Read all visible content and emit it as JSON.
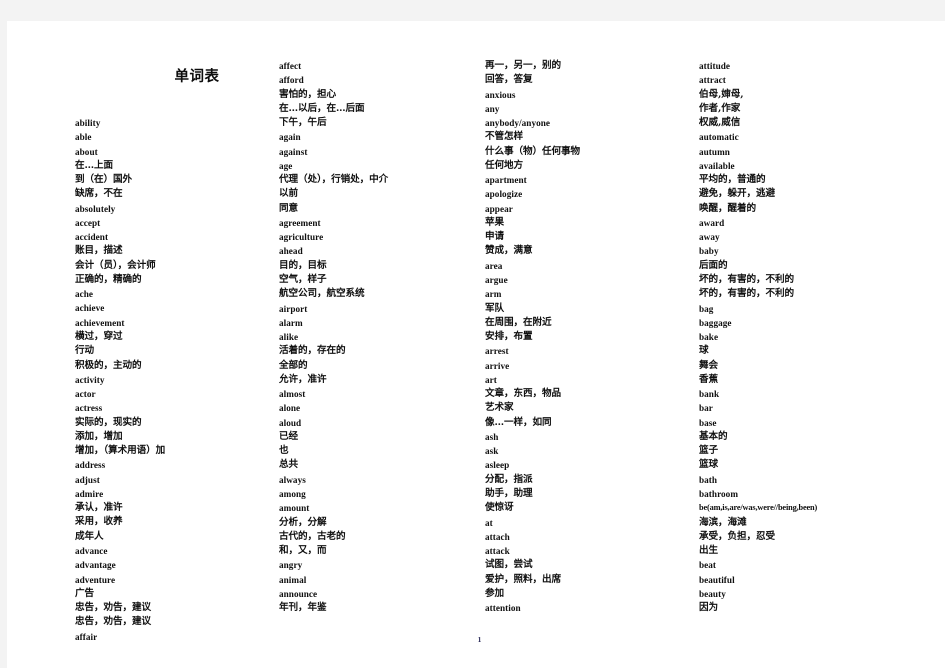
{
  "document": {
    "title": "单词表",
    "page_number": "1"
  },
  "columns": [
    {
      "id": "col-1",
      "entries": [
        {
          "text": "ability",
          "lang": "en"
        },
        {
          "text": "able",
          "lang": "en"
        },
        {
          "text": "about",
          "lang": "en"
        },
        {
          "text": "在…上面",
          "lang": "cn"
        },
        {
          "text": "到（在）国外",
          "lang": "cn"
        },
        {
          "text": "缺席，不在",
          "lang": "cn"
        },
        {
          "text": "absolutely",
          "lang": "en"
        },
        {
          "text": "accept",
          "lang": "en"
        },
        {
          "text": "accident",
          "lang": "en"
        },
        {
          "text": "账目，描述",
          "lang": "cn"
        },
        {
          "text": "会计（员），会计师",
          "lang": "cn"
        },
        {
          "text": "正确的，精确的",
          "lang": "cn"
        },
        {
          "text": "ache",
          "lang": "en"
        },
        {
          "text": "achieve",
          "lang": "en"
        },
        {
          "text": "achievement",
          "lang": "en"
        },
        {
          "text": "横过，穿过",
          "lang": "cn"
        },
        {
          "text": "行动",
          "lang": "cn"
        },
        {
          "text": "积极的，主动的",
          "lang": "cn"
        },
        {
          "text": "activity",
          "lang": "en"
        },
        {
          "text": "actor",
          "lang": "en"
        },
        {
          "text": "actress",
          "lang": "en"
        },
        {
          "text": "实际的，现实的",
          "lang": "cn"
        },
        {
          "text": "添加，增加",
          "lang": "cn"
        },
        {
          "text": "增加，（算术用语）加",
          "lang": "cn"
        },
        {
          "text": "address",
          "lang": "en"
        },
        {
          "text": "adjust",
          "lang": "en"
        },
        {
          "text": "admire",
          "lang": "en"
        },
        {
          "text": "承认，准许",
          "lang": "cn"
        },
        {
          "text": "采用，收养",
          "lang": "cn"
        },
        {
          "text": "成年人",
          "lang": "cn"
        },
        {
          "text": "advance",
          "lang": "en"
        },
        {
          "text": "advantage",
          "lang": "en"
        },
        {
          "text": "adventure",
          "lang": "en"
        },
        {
          "text": "广告",
          "lang": "cn"
        },
        {
          "text": "忠告，劝告，建议",
          "lang": "cn"
        },
        {
          "text": "忠告，劝告，建议",
          "lang": "cn"
        },
        {
          "text": "affair",
          "lang": "en"
        }
      ]
    },
    {
      "id": "col-2",
      "entries": [
        {
          "text": "affect",
          "lang": "en"
        },
        {
          "text": "afford",
          "lang": "en"
        },
        {
          "text": "害怕的，担心",
          "lang": "cn"
        },
        {
          "text": "在…以后，在…后面",
          "lang": "cn"
        },
        {
          "text": "下午，午后",
          "lang": "cn"
        },
        {
          "text": "again",
          "lang": "en"
        },
        {
          "text": "against",
          "lang": "en"
        },
        {
          "text": "age",
          "lang": "en"
        },
        {
          "text": "代理（处），行销处，中介",
          "lang": "cn"
        },
        {
          "text": "以前",
          "lang": "cn"
        },
        {
          "text": "同意",
          "lang": "cn"
        },
        {
          "text": "agreement",
          "lang": "en"
        },
        {
          "text": "agriculture",
          "lang": "en"
        },
        {
          "text": "ahead",
          "lang": "en"
        },
        {
          "text": "目的，目标",
          "lang": "cn"
        },
        {
          "text": "空气，样子",
          "lang": "cn"
        },
        {
          "text": "航空公司，航空系统",
          "lang": "cn"
        },
        {
          "text": "airport",
          "lang": "en"
        },
        {
          "text": "alarm",
          "lang": "en"
        },
        {
          "text": "alike",
          "lang": "en"
        },
        {
          "text": "活着的，存在的",
          "lang": "cn"
        },
        {
          "text": "全部的",
          "lang": "cn"
        },
        {
          "text": "允许，准许",
          "lang": "cn"
        },
        {
          "text": "almost",
          "lang": "en"
        },
        {
          "text": "alone",
          "lang": "en"
        },
        {
          "text": "aloud",
          "lang": "en"
        },
        {
          "text": "已经",
          "lang": "cn"
        },
        {
          "text": "也",
          "lang": "cn"
        },
        {
          "text": "总共",
          "lang": "cn"
        },
        {
          "text": "always",
          "lang": "en"
        },
        {
          "text": "among",
          "lang": "en"
        },
        {
          "text": "amount",
          "lang": "en"
        },
        {
          "text": "分析，分解",
          "lang": "cn"
        },
        {
          "text": "古代的，古老的",
          "lang": "cn"
        },
        {
          "text": "和，又，而",
          "lang": "cn"
        },
        {
          "text": "angry",
          "lang": "en"
        },
        {
          "text": "animal",
          "lang": "en"
        },
        {
          "text": "announce",
          "lang": "en"
        },
        {
          "text": "年刊，年鉴",
          "lang": "cn"
        }
      ]
    },
    {
      "id": "col-3",
      "entries": [
        {
          "text": "再一，另一，别的",
          "lang": "cn"
        },
        {
          "text": "回答，答复",
          "lang": "cn"
        },
        {
          "text": "anxious",
          "lang": "en"
        },
        {
          "text": "any",
          "lang": "en"
        },
        {
          "text": "anybody/anyone",
          "lang": "en"
        },
        {
          "text": "不管怎样",
          "lang": "cn"
        },
        {
          "text": "什么事（物）任何事物",
          "lang": "cn"
        },
        {
          "text": "任何地方",
          "lang": "cn"
        },
        {
          "text": "apartment",
          "lang": "en"
        },
        {
          "text": "apologize",
          "lang": "en"
        },
        {
          "text": "appear",
          "lang": "en"
        },
        {
          "text": "苹果",
          "lang": "cn"
        },
        {
          "text": "申请",
          "lang": "cn"
        },
        {
          "text": "赞成，满意",
          "lang": "cn"
        },
        {
          "text": "area",
          "lang": "en"
        },
        {
          "text": "argue",
          "lang": "en"
        },
        {
          "text": "arm",
          "lang": "en"
        },
        {
          "text": "军队",
          "lang": "cn"
        },
        {
          "text": "在周围，在附近",
          "lang": "cn"
        },
        {
          "text": "安排，布置",
          "lang": "cn"
        },
        {
          "text": "arrest",
          "lang": "en"
        },
        {
          "text": "arrive",
          "lang": "en"
        },
        {
          "text": "art",
          "lang": "en"
        },
        {
          "text": "文章，东西，物品",
          "lang": "cn"
        },
        {
          "text": "艺术家",
          "lang": "cn"
        },
        {
          "text": "像…一样，如同",
          "lang": "cn"
        },
        {
          "text": "ash",
          "lang": "en"
        },
        {
          "text": "ask",
          "lang": "en"
        },
        {
          "text": "asleep",
          "lang": "en"
        },
        {
          "text": "分配，指派",
          "lang": "cn"
        },
        {
          "text": "助手，助理",
          "lang": "cn"
        },
        {
          "text": "使惊讶",
          "lang": "cn"
        },
        {
          "text": "at",
          "lang": "en"
        },
        {
          "text": "attach",
          "lang": "en"
        },
        {
          "text": "attack",
          "lang": "en"
        },
        {
          "text": "试图，尝试",
          "lang": "cn"
        },
        {
          "text": "爱护，照料，出席",
          "lang": "cn"
        },
        {
          "text": "参加",
          "lang": "cn"
        },
        {
          "text": "attention",
          "lang": "en"
        }
      ]
    },
    {
      "id": "col-4",
      "entries": [
        {
          "text": "attitude",
          "lang": "en"
        },
        {
          "text": "attract",
          "lang": "en"
        },
        {
          "text": "伯母,婶母,",
          "lang": "cn"
        },
        {
          "text": "作者,作家",
          "lang": "cn"
        },
        {
          "text": "权威,威信",
          "lang": "cn"
        },
        {
          "text": "automatic",
          "lang": "en"
        },
        {
          "text": "autumn",
          "lang": "en"
        },
        {
          "text": "available",
          "lang": "en"
        },
        {
          "text": "平均的，普通的",
          "lang": "cn"
        },
        {
          "text": "避免，躲开，逃避",
          "lang": "cn"
        },
        {
          "text": "唤醒，醒着的",
          "lang": "cn"
        },
        {
          "text": "award",
          "lang": "en"
        },
        {
          "text": "away",
          "lang": "en"
        },
        {
          "text": "baby",
          "lang": "en"
        },
        {
          "text": "后面的",
          "lang": "cn"
        },
        {
          "text": "坏的，有害的，不利的",
          "lang": "cn"
        },
        {
          "text": "坏的，有害的，不利的",
          "lang": "cn"
        },
        {
          "text": "bag",
          "lang": "en"
        },
        {
          "text": "baggage",
          "lang": "en"
        },
        {
          "text": "bake",
          "lang": "en"
        },
        {
          "text": "球",
          "lang": "cn"
        },
        {
          "text": "舞会",
          "lang": "cn"
        },
        {
          "text": "香蕉",
          "lang": "cn"
        },
        {
          "text": "bank",
          "lang": "en"
        },
        {
          "text": "bar",
          "lang": "en"
        },
        {
          "text": "base",
          "lang": "en"
        },
        {
          "text": "基本的",
          "lang": "cn"
        },
        {
          "text": "篮子",
          "lang": "cn"
        },
        {
          "text": "篮球",
          "lang": "cn"
        },
        {
          "text": "bath",
          "lang": "en"
        },
        {
          "text": "bathroom",
          "lang": "en"
        },
        {
          "text": "be(am,is,are/was,were//being,been)",
          "lang": "tiny"
        },
        {
          "text": "海滨，海滩",
          "lang": "cn"
        },
        {
          "text": "承受，负担，忍受",
          "lang": "cn"
        },
        {
          "text": "出生",
          "lang": "cn"
        },
        {
          "text": "beat",
          "lang": "en"
        },
        {
          "text": "beautiful",
          "lang": "en"
        },
        {
          "text": "beauty",
          "lang": "en"
        },
        {
          "text": "因为",
          "lang": "cn"
        }
      ]
    }
  ]
}
